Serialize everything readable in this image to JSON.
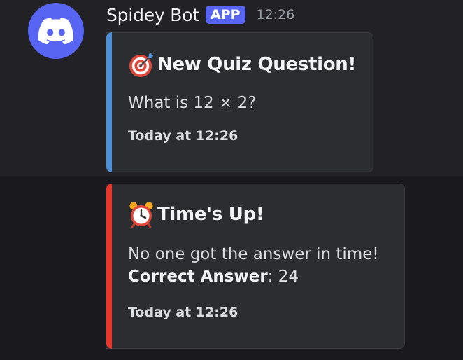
{
  "message": {
    "username": "Spidey Bot",
    "badge": "APP",
    "timestamp": "12:26",
    "avatar_icon": "discord-logo-icon",
    "colors": {
      "avatar": "#5865f2",
      "badge": "#5865f2",
      "embed1_accent": "#4f8fd8",
      "embed2_accent": "#e8362b"
    }
  },
  "embeds": [
    {
      "title_icon": "direct-hit-icon",
      "title": "New Quiz Question!",
      "description": "What is 12 × 2?",
      "footer": "Today at 12:26"
    },
    {
      "title_icon": "alarm-clock-icon",
      "title": "Time's Up!",
      "description": "No one got the answer in time!",
      "answer_label": "Correct Answer",
      "answer_sep": ": ",
      "answer_value": "24",
      "footer": "Today at 12:26"
    }
  ]
}
